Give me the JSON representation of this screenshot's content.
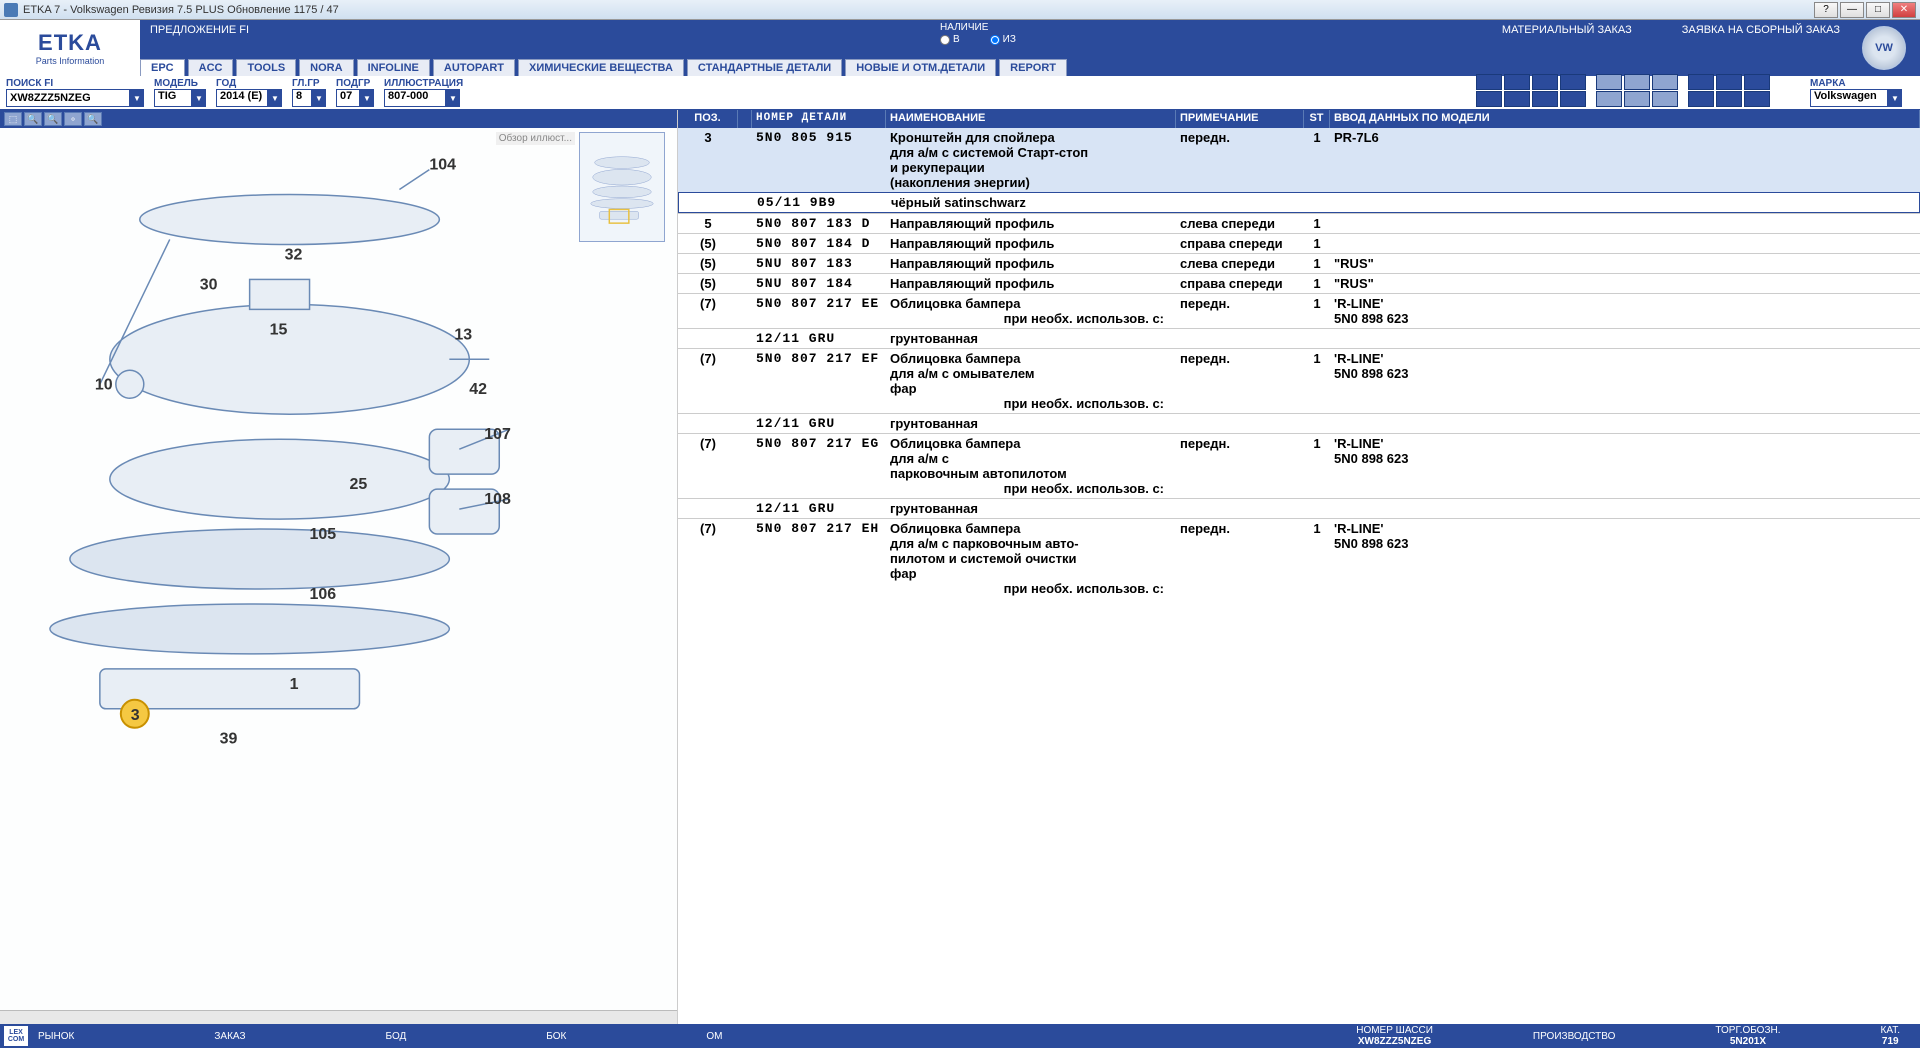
{
  "window": {
    "title": "ETKA 7 - Volkswagen Ревизия 7.5 PLUS Обновление 1175 / 47"
  },
  "logo": {
    "main": "ETKA",
    "sub": "Parts Information"
  },
  "header": {
    "offer": "ПРЕДЛОЖЕНИЕ FI",
    "stock_label": "НАЛИЧИЕ",
    "radio_v": "В",
    "radio_iz": "ИЗ",
    "link1": "МАТЕРИАЛЬНЫЙ ЗАКАЗ",
    "link2": "ЗАЯВКА НА СБОРНЫЙ ЗАКАЗ"
  },
  "tabs": [
    "EPC",
    "ACC",
    "TOOLS",
    "NORA",
    "INFOLINE",
    "AUTOPART",
    "ХИМИЧЕСКИЕ ВЕЩЕСТВА",
    "СТАНДАРТНЫЕ ДЕТАЛИ",
    "НОВЫЕ И ОТМ.ДЕТАЛИ",
    "REPORT"
  ],
  "filters": {
    "search_label": "ПОИСК FI",
    "search_value": "XW8ZZZ5NZEG",
    "model_label": "МОДЕЛЬ",
    "model_value": "TIG",
    "year_label": "ГОД",
    "year_value": "2014 (E)",
    "glgr_label": "ГЛ.ГР",
    "glgr_value": "8",
    "subgr_label": "ПОДГР",
    "subgr_value": "07",
    "illus_label": "ИЛЛЮСТРАЦИЯ",
    "illus_value": "807-000",
    "brand_label": "МАРКА",
    "brand_value": "Volkswagen"
  },
  "thumb_label": "Обзор иллюст...",
  "columns": {
    "pos": "ПОЗ.",
    "part": "НОМЕР ДЕТАЛИ",
    "name": "НАИМЕНОВАНИЕ",
    "note": "ПРИМЕЧАНИЕ",
    "st": "ST",
    "model": "ВВОД ДАННЫХ ПО МОДЕЛИ"
  },
  "rows": [
    {
      "pos": "3",
      "part": "5N0 805 915",
      "name": [
        "Кронштейн для спойлера",
        "для а/м с системой Старт-стоп",
        "и рекуперации",
        "(накопления энергии)"
      ],
      "note": "передн.",
      "st": "1",
      "model": "PR-7L6",
      "selected": true
    },
    {
      "box": true,
      "part": "05/11      9B9",
      "name": [
        "чёрный satinschwarz"
      ]
    },
    {
      "pos": "5",
      "part": "5N0 807 183 D",
      "name": [
        "Направляющий профиль"
      ],
      "note": "слева спереди",
      "st": "1",
      "sep": true
    },
    {
      "pos": "(5)",
      "part": "5N0 807 184 D",
      "name": [
        "Направляющий профиль"
      ],
      "note": "справа спереди",
      "st": "1",
      "sep": true
    },
    {
      "pos": "(5)",
      "part": "5NU 807 183",
      "name": [
        "Направляющий профиль"
      ],
      "note": "слева спереди",
      "st": "1",
      "model": "\"RUS\"",
      "sep": true
    },
    {
      "pos": "(5)",
      "part": "5NU 807 184",
      "name": [
        "Направляющий профиль"
      ],
      "note": "справа спереди",
      "st": "1",
      "model": "\"RUS\"",
      "sep": true
    },
    {
      "pos": "(7)",
      "part": "5N0 807 217 EE",
      "name": [
        "Облицовка бампера"
      ],
      "note": "передн.",
      "st": "1",
      "model": "'R-LINE'",
      "usage": "при необх. использов. с:",
      "usage_part": "5N0 898 623",
      "sep": true
    },
    {
      "part": "12/11      GRU",
      "name": [
        "грунтованная"
      ],
      "sep": true
    },
    {
      "pos": "(7)",
      "part": "5N0 807 217 EF",
      "name": [
        "Облицовка бампера",
        "для а/м с омывателем",
        "фар"
      ],
      "note": "передн.",
      "st": "1",
      "model": "'R-LINE'",
      "usage": "при необх. использов. с:",
      "usage_part": "5N0 898 623",
      "sep": true
    },
    {
      "part": "12/11      GRU",
      "name": [
        "грунтованная"
      ],
      "sep": true
    },
    {
      "pos": "(7)",
      "part": "5N0 807 217 EG",
      "name": [
        "Облицовка бампера",
        "для а/м с",
        "парковочным автопилотом"
      ],
      "note": "передн.",
      "st": "1",
      "model": "'R-LINE'",
      "usage": "при необх. использов. с:",
      "usage_part": "5N0 898 623",
      "sep": true
    },
    {
      "part": "12/11      GRU",
      "name": [
        "грунтованная"
      ],
      "sep": true
    },
    {
      "pos": "(7)",
      "part": "5N0 807 217 EH",
      "name": [
        "Облицовка бампера",
        "для а/м с парковочным авто-",
        "пилотом и системой очистки",
        "фар"
      ],
      "note": "передн.",
      "st": "1",
      "model": "'R-LINE'",
      "usage": "при необх. использов. с:",
      "usage_part": "5N0 898 623",
      "sep": true
    }
  ],
  "callouts": [
    "104",
    "32",
    "30",
    "15",
    "13",
    "10",
    "42",
    "107",
    "25",
    "108",
    "105",
    "106",
    "1",
    "3",
    "39"
  ],
  "status": {
    "market": "РЫНОК",
    "order": "ЗАКАЗ",
    "bod": "БОД",
    "bok": "БОК",
    "om": "ОМ",
    "chassis_lbl": "НОМЕР ШАССИ",
    "chassis": "XW8ZZZ5NZEG",
    "prod_lbl": "ПРОИЗВОДСТВО",
    "torg_lbl": "ТОРГ.ОБОЗН.",
    "torg": "5N201X",
    "cat_lbl": "КАТ.",
    "cat": "719"
  }
}
